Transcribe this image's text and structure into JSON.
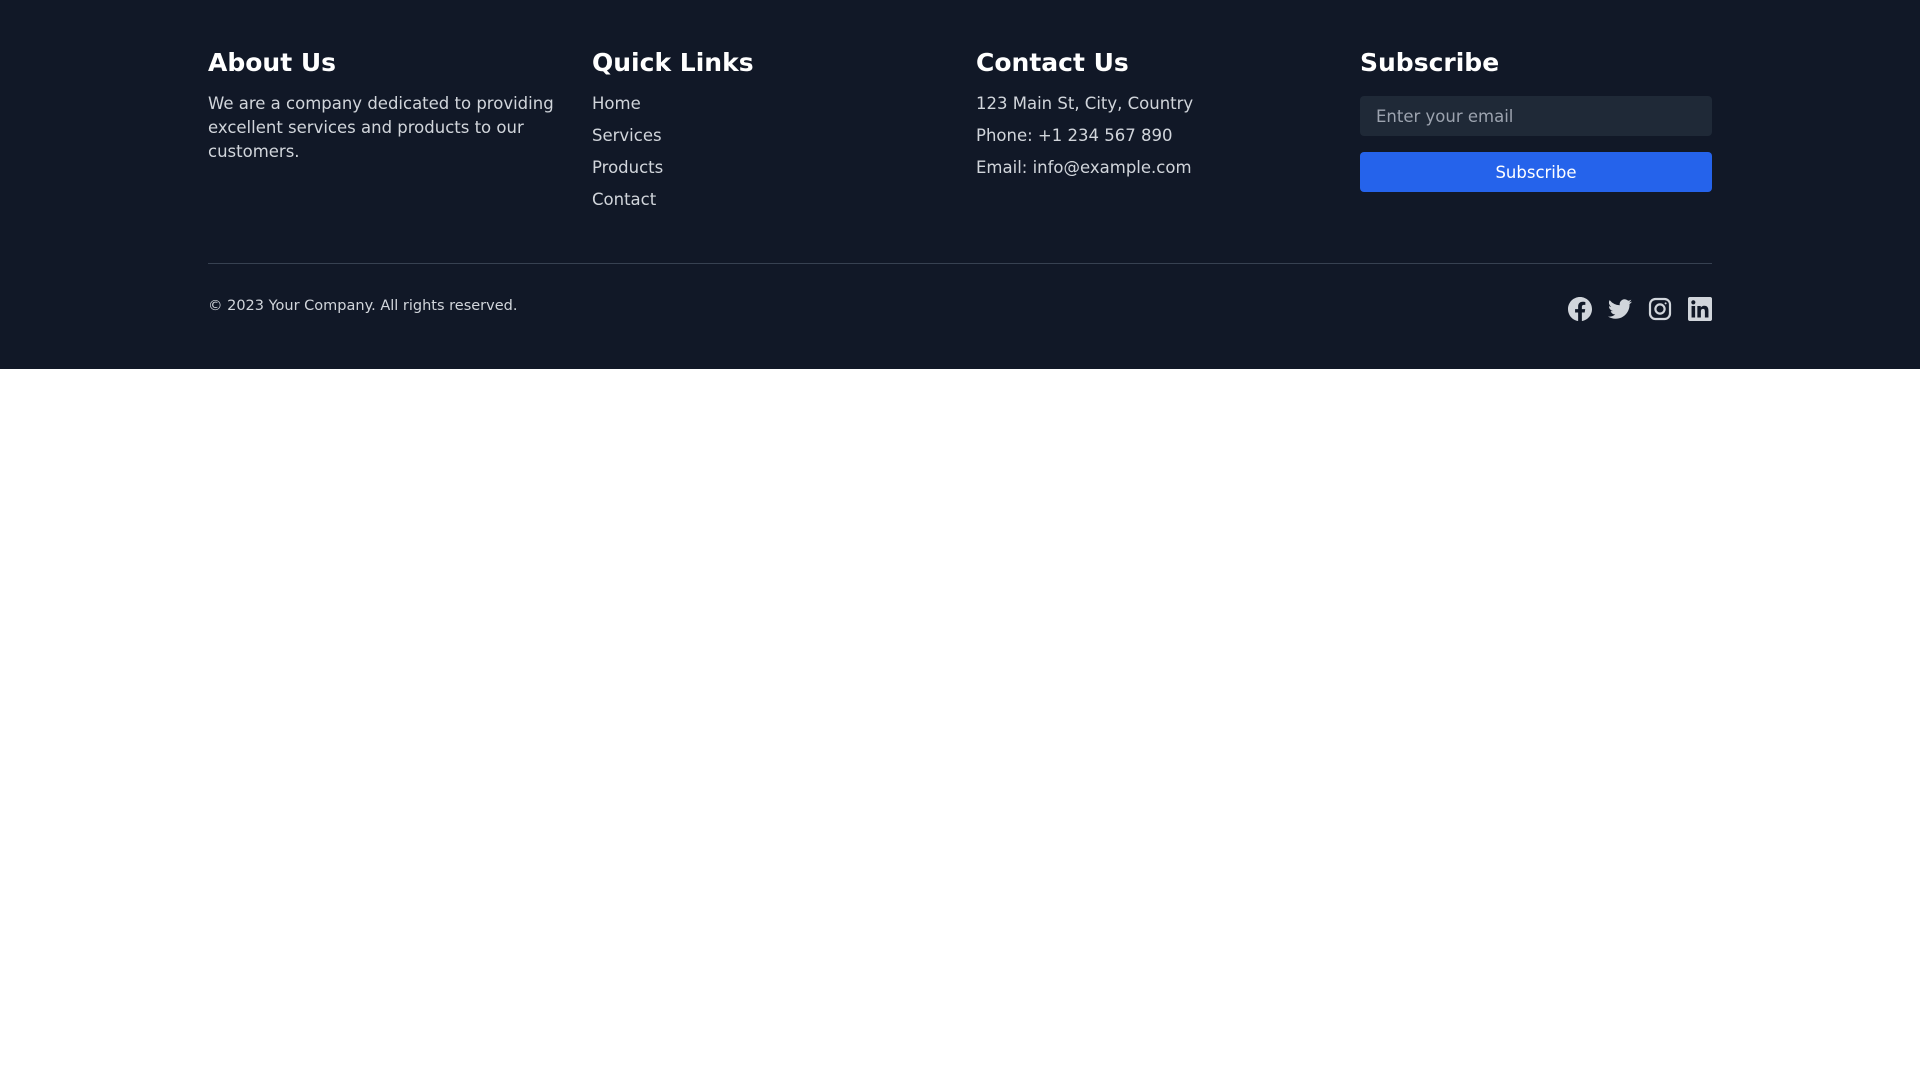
{
  "about": {
    "heading": "About Us",
    "text": "We are a company dedicated to providing excellent services and products to our customers."
  },
  "quick_links": {
    "heading": "Quick Links",
    "items": [
      {
        "label": "Home"
      },
      {
        "label": "Services"
      },
      {
        "label": "Products"
      },
      {
        "label": "Contact"
      }
    ]
  },
  "contact": {
    "heading": "Contact Us",
    "address": "123 Main St, City, Country",
    "phone": "Phone: +1 234 567 890",
    "email": "Email: info@example.com"
  },
  "subscribe": {
    "heading": "Subscribe",
    "placeholder": "Enter your email",
    "value": "",
    "button_label": "Subscribe",
    "button_color": "#2563eb"
  },
  "bottom": {
    "copyright": "© 2023 Your Company. All rights reserved.",
    "social_icons": [
      "facebook-icon",
      "twitter-icon",
      "instagram-icon",
      "linkedin-icon"
    ]
  },
  "colors": {
    "footer_bg": "#111827",
    "input_bg": "#1f2937",
    "text": "#d1d5db",
    "heading": "#ffffff",
    "page_bg": "#ffffff"
  }
}
